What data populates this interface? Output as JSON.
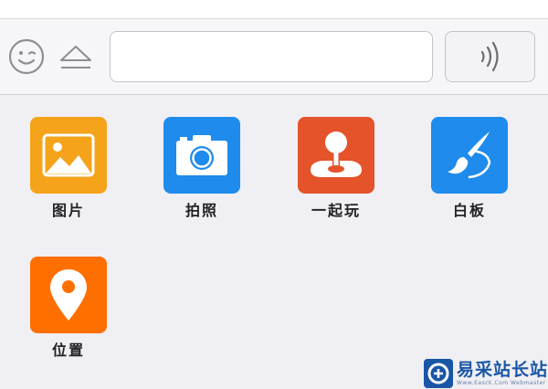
{
  "colors": {
    "background": "#efeff4",
    "toolbar": "#f6f6f8",
    "icon_gray": "#8e8e93",
    "photo_tile": "#f5a31a",
    "camera_tile": "#1f8bec",
    "play_tile": "#e4532a",
    "whiteboard_tile": "#1f8bec",
    "location_tile": "#ff6f00",
    "watermark_blue": "#1a56a6"
  },
  "toolbar": {
    "emoji_icon": "smiley-face-icon",
    "keyboard_toggle_icon": "eject-triangle-icon",
    "input_value": "",
    "input_placeholder": "",
    "voice_icon": "sound-waves-icon"
  },
  "panel": {
    "items": [
      {
        "label": "图片",
        "icon": "image-icon",
        "color": "#f5a31a"
      },
      {
        "label": "拍照",
        "icon": "camera-icon",
        "color": "#1f8bec"
      },
      {
        "label": "一起玩",
        "icon": "joystick-icon",
        "color": "#e4532a"
      },
      {
        "label": "白板",
        "icon": "paintbrush-icon",
        "color": "#1f8bec"
      },
      {
        "label": "位置",
        "icon": "location-pin-icon",
        "color": "#ff6f00"
      }
    ]
  },
  "watermark": {
    "title": "易采站长站",
    "subtitle": "Www.Easck.Com Webmaster",
    "icon": "easck-logo-icon"
  }
}
